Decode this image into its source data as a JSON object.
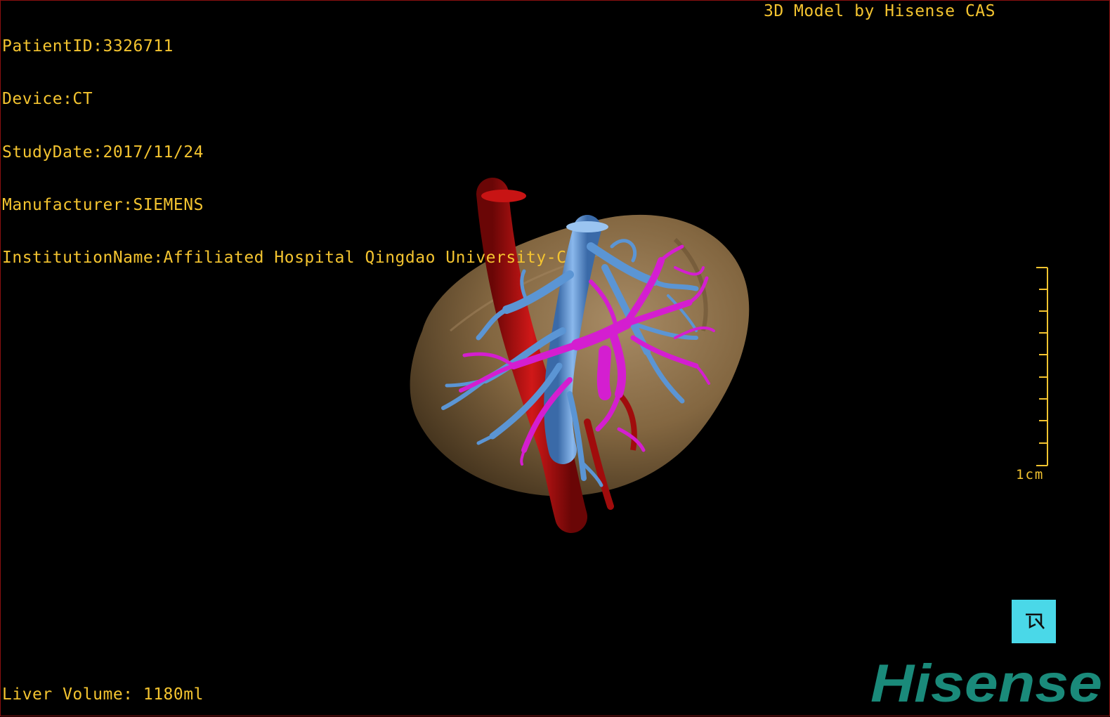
{
  "overlay": {
    "patient_id": "PatientID:3326711",
    "device": "Device:CT",
    "study_date": "StudyDate:2017/11/24",
    "manufacturer": "Manufacturer:SIEMENS",
    "institution": "InstitutionName:Affiliated Hospital Qingdao University-C",
    "title": "3D Model by Hisense CAS",
    "liver_volume": "Liver Volume: 1180ml"
  },
  "scale": {
    "label": "1cm",
    "color": "#f4c430"
  },
  "orientation_cube": {
    "icon": "orientation-cube-icon",
    "color": "#4ad8e8"
  },
  "brand": {
    "logo_text": "Hisense",
    "color": "#1a8a7a"
  },
  "model": {
    "structures": [
      "liver-parenchyma",
      "inferior-vena-cava",
      "hepatic-veins",
      "portal-veins",
      "hepatic-artery"
    ],
    "colors": {
      "liver": "#8a6c44",
      "artery": "#b00c0c",
      "vena": "#5b95d4",
      "portal": "#d41ed0",
      "background": "#000000"
    }
  }
}
